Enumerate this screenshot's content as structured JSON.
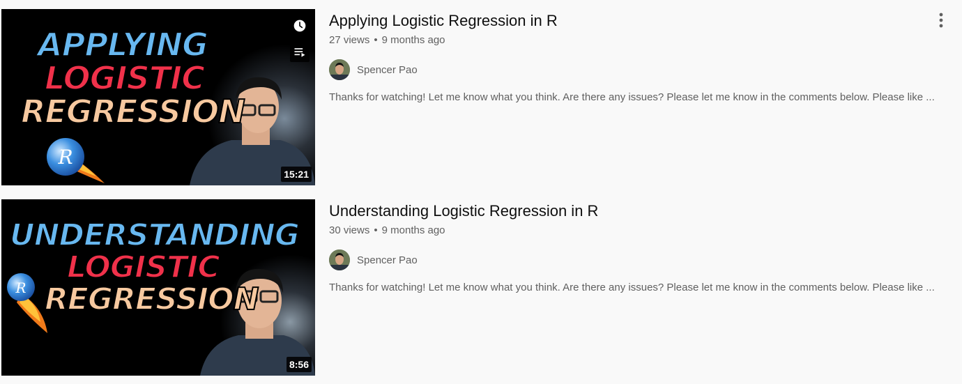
{
  "videos": [
    {
      "title": "Applying Logistic Regression in R",
      "views": "27 views",
      "age": "9 months ago",
      "channel": "Spencer Pao",
      "description": "Thanks for watching! Let me know what you think. Are there any issues? Please let me know in the comments below. Please like ...",
      "duration": "15:21",
      "thumb_words": [
        "APPLYING",
        "LOGISTIC",
        "REGRESSION"
      ]
    },
    {
      "title": "Understanding Logistic Regression in R",
      "views": "30 views",
      "age": "9 months ago",
      "channel": "Spencer Pao",
      "description": "Thanks for watching! Let me know what you think. Are there any issues? Please let me know in the comments below. Please like ...",
      "duration": "8:56",
      "thumb_words": [
        "UNDERSTANDING",
        "LOGISTIC",
        "REGRESSION"
      ]
    }
  ],
  "icons": {
    "watch_later": "clock-icon",
    "add_to_queue": "queue-icon",
    "more": "more-vertical-icon",
    "r_logo": "r-logo-icon"
  },
  "colors": {
    "page_bg": "#f9f9f9",
    "title": "#0f0f0f",
    "meta": "#606060",
    "thumb_blue": "#68b8f0",
    "thumb_red": "#f0314a",
    "thumb_peach": "#f7c9a0"
  }
}
